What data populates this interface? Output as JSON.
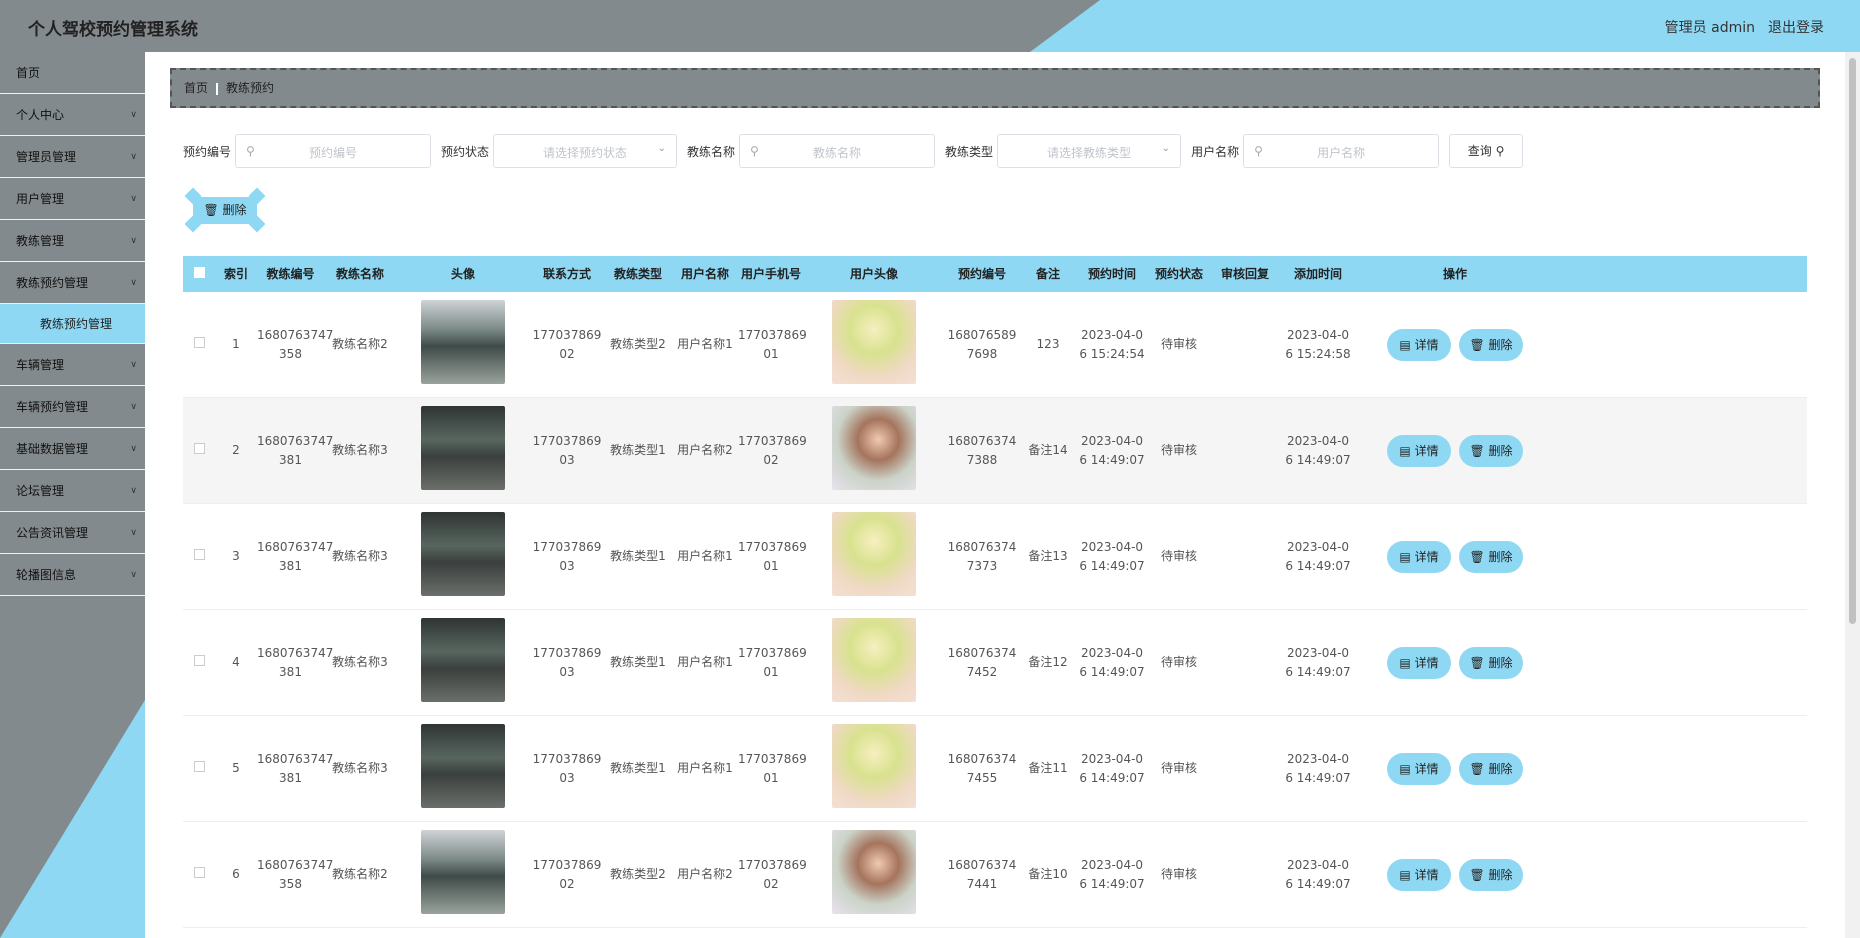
{
  "app": {
    "title": "个人驾校预约管理系统",
    "user": "管理员 admin",
    "logout": "退出登录"
  },
  "colors": {
    "accent": "#8fd8f4",
    "chrome": "#838a8d"
  },
  "sidebar": {
    "items": [
      {
        "label": "首页",
        "chevron": false
      },
      {
        "label": "个人中心",
        "chevron": true
      },
      {
        "label": "管理员管理",
        "chevron": true
      },
      {
        "label": "用户管理",
        "chevron": true
      },
      {
        "label": "教练管理",
        "chevron": true
      },
      {
        "label": "教练预约管理",
        "chevron": true
      },
      {
        "label": "教练预约管理",
        "sub": true
      },
      {
        "label": "车辆管理",
        "chevron": true
      },
      {
        "label": "车辆预约管理",
        "chevron": true
      },
      {
        "label": "基础数据管理",
        "chevron": true
      },
      {
        "label": "论坛管理",
        "chevron": true
      },
      {
        "label": "公告资讯管理",
        "chevron": true
      },
      {
        "label": "轮播图信息",
        "chevron": true
      }
    ]
  },
  "breadcrumb": {
    "home": "首页",
    "current": "教练预约"
  },
  "search": {
    "order_no_label": "预约编号",
    "order_no_placeholder": "预约编号",
    "status_label": "预约状态",
    "status_placeholder": "请选择预约状态",
    "coach_name_label": "教练名称",
    "coach_name_placeholder": "教练名称",
    "coach_type_label": "教练类型",
    "coach_type_placeholder": "请选择教练类型",
    "user_name_label": "用户名称",
    "user_name_placeholder": "用户名称",
    "query_button": "查询"
  },
  "toolbar": {
    "delete_button": "删除"
  },
  "table": {
    "headers": [
      "索引",
      "教练编号",
      "教练名称",
      "头像",
      "联系方式",
      "教练类型",
      "用户名称",
      "用户手机号",
      "用户头像",
      "预约编号",
      "备注",
      "预约时间",
      "预约状态",
      "审核回复",
      "添加时间",
      "操作"
    ],
    "detail_label": "详情",
    "delete_label": "删除",
    "rows": [
      {
        "index": "1",
        "coach_no": [
          "1680763747",
          "358"
        ],
        "coach_name": "教练名称2",
        "coach_img": "coach-a",
        "phone": [
          "177037869",
          "02"
        ],
        "coach_type": "教练类型2",
        "user_name": "用户名称1",
        "user_phone": [
          "177037869",
          "01"
        ],
        "user_img": "user-a",
        "order_no": [
          "168076589",
          "7698"
        ],
        "remark": "123",
        "order_time": [
          "2023-04-0",
          "6 15:24:54"
        ],
        "status": "待审核",
        "reply": "",
        "add_time": [
          "2023-04-0",
          "6 15:24:58"
        ]
      },
      {
        "index": "2",
        "coach_no": [
          "1680763747",
          "381"
        ],
        "coach_name": "教练名称3",
        "coach_img": "coach-b",
        "phone": [
          "177037869",
          "03"
        ],
        "coach_type": "教练类型1",
        "user_name": "用户名称2",
        "user_phone": [
          "177037869",
          "02"
        ],
        "user_img": "user-b",
        "order_no": [
          "168076374",
          "7388"
        ],
        "remark": "备注14",
        "order_time": [
          "2023-04-0",
          "6 14:49:07"
        ],
        "status": "待审核",
        "reply": "",
        "add_time": [
          "2023-04-0",
          "6 14:49:07"
        ]
      },
      {
        "index": "3",
        "coach_no": [
          "1680763747",
          "381"
        ],
        "coach_name": "教练名称3",
        "coach_img": "coach-b",
        "phone": [
          "177037869",
          "03"
        ],
        "coach_type": "教练类型1",
        "user_name": "用户名称1",
        "user_phone": [
          "177037869",
          "01"
        ],
        "user_img": "user-a",
        "order_no": [
          "168076374",
          "7373"
        ],
        "remark": "备注13",
        "order_time": [
          "2023-04-0",
          "6 14:49:07"
        ],
        "status": "待审核",
        "reply": "",
        "add_time": [
          "2023-04-0",
          "6 14:49:07"
        ]
      },
      {
        "index": "4",
        "coach_no": [
          "1680763747",
          "381"
        ],
        "coach_name": "教练名称3",
        "coach_img": "coach-b",
        "phone": [
          "177037869",
          "03"
        ],
        "coach_type": "教练类型1",
        "user_name": "用户名称1",
        "user_phone": [
          "177037869",
          "01"
        ],
        "user_img": "user-a",
        "order_no": [
          "168076374",
          "7452"
        ],
        "remark": "备注12",
        "order_time": [
          "2023-04-0",
          "6 14:49:07"
        ],
        "status": "待审核",
        "reply": "",
        "add_time": [
          "2023-04-0",
          "6 14:49:07"
        ]
      },
      {
        "index": "5",
        "coach_no": [
          "1680763747",
          "381"
        ],
        "coach_name": "教练名称3",
        "coach_img": "coach-b",
        "phone": [
          "177037869",
          "03"
        ],
        "coach_type": "教练类型1",
        "user_name": "用户名称1",
        "user_phone": [
          "177037869",
          "01"
        ],
        "user_img": "user-a",
        "order_no": [
          "168076374",
          "7455"
        ],
        "remark": "备注11",
        "order_time": [
          "2023-04-0",
          "6 14:49:07"
        ],
        "status": "待审核",
        "reply": "",
        "add_time": [
          "2023-04-0",
          "6 14:49:07"
        ]
      },
      {
        "index": "6",
        "coach_no": [
          "1680763747",
          "358"
        ],
        "coach_name": "教练名称2",
        "coach_img": "coach-a",
        "phone": [
          "177037869",
          "02"
        ],
        "coach_type": "教练类型2",
        "user_name": "用户名称2",
        "user_phone": [
          "177037869",
          "02"
        ],
        "user_img": "user-b",
        "order_no": [
          "168076374",
          "7441"
        ],
        "remark": "备注10",
        "order_time": [
          "2023-04-0",
          "6 14:49:07"
        ],
        "status": "待审核",
        "reply": "",
        "add_time": [
          "2023-04-0",
          "6 14:49:07"
        ]
      }
    ]
  }
}
